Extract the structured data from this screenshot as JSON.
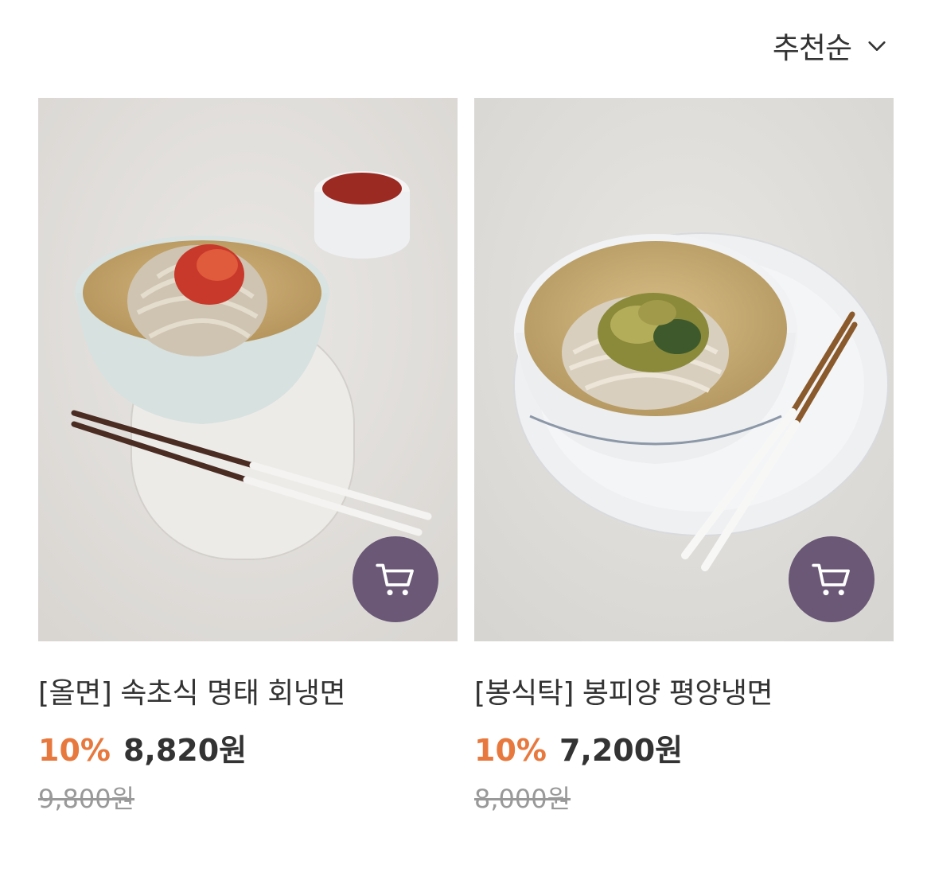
{
  "sort": {
    "label": "추천순",
    "icon": "chevron-down-icon"
  },
  "products": [
    {
      "title": "[올면] 속초식 명태 회냉면",
      "discount": "10%",
      "sale_price": "8,820원",
      "original_price": "9,800원",
      "image_desc": "cold noodle bowl with spicy pollack topping",
      "cart_icon": "cart-icon"
    },
    {
      "title": "[봉식탁] 봉피양 평양냉면",
      "discount": "10%",
      "sale_price": "7,200원",
      "original_price": "8,000원",
      "image_desc": "pyongyang cold noodle bowl with pickled greens",
      "cart_icon": "cart-icon"
    }
  ],
  "colors": {
    "accent_discount": "#e8793e",
    "cart_button": "#6a5876",
    "text_primary": "#333333",
    "text_muted": "#999999"
  }
}
